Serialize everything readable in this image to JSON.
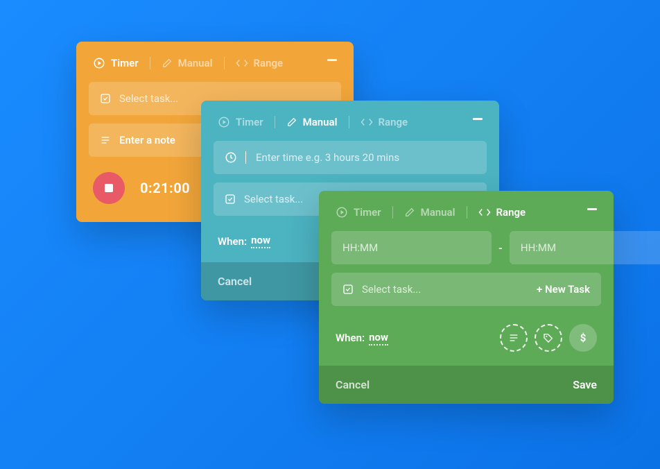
{
  "tabs": {
    "timer": "Timer",
    "manual": "Manual",
    "range": "Range"
  },
  "orange": {
    "select_task_ph": "Select task...",
    "note_text": "Enter a note",
    "time": "0:21:00"
  },
  "teal": {
    "time_ph": "Enter time e.g. 3 hours 20 mins",
    "select_task_ph": "Select task...",
    "when_label": "When:",
    "when_value": "now",
    "cancel": "Cancel"
  },
  "green": {
    "hhmm_ph": "HH:MM",
    "dash": "-",
    "select_task_ph": "Select task...",
    "new_task": "+ New Task",
    "when_label": "When:",
    "when_value": "now",
    "dollar": "$",
    "cancel": "Cancel",
    "save": "Save"
  }
}
